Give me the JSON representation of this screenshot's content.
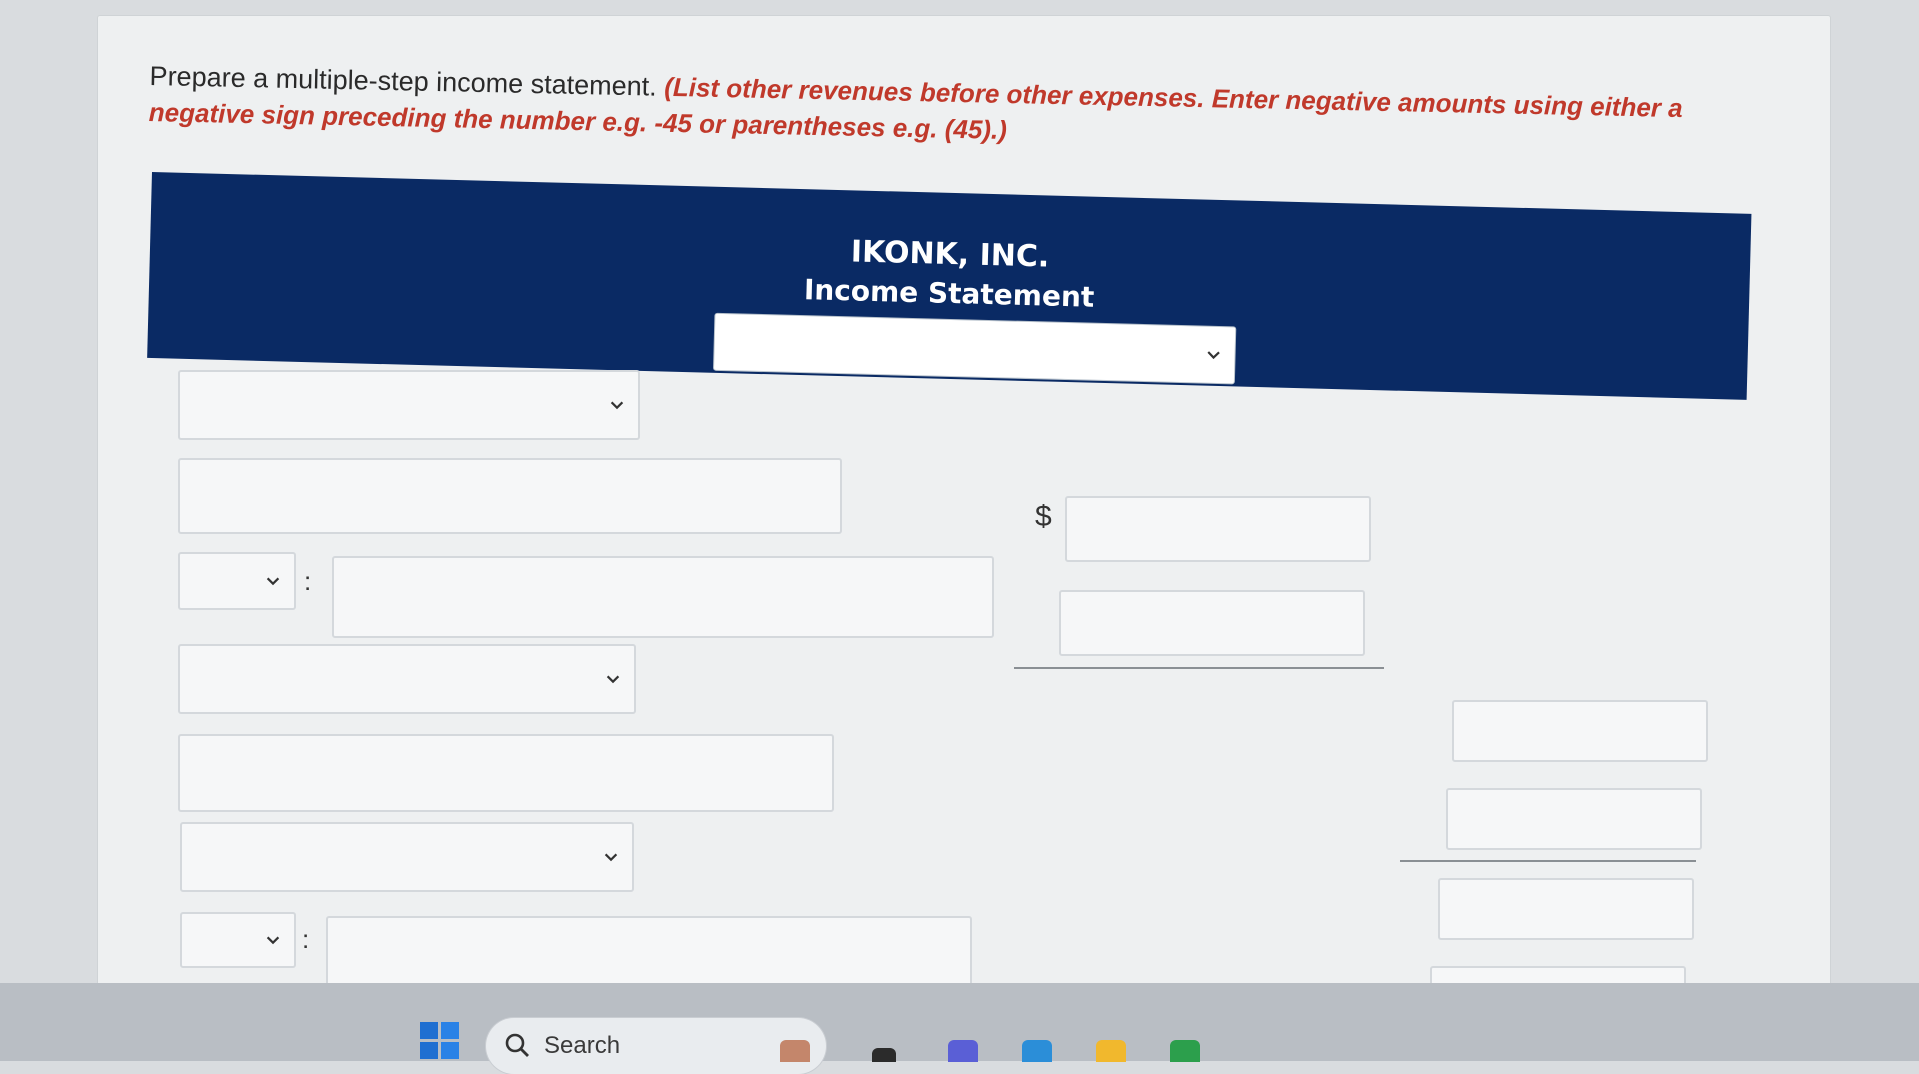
{
  "instructions": {
    "lead": "Prepare a multiple-step income statement.",
    "hint": "(List other revenues before other expenses. Enter negative amounts using either a negative sign preceding the number e.g. -45 or parentheses e.g. (45).)"
  },
  "header": {
    "company": "IKONK, INC.",
    "statement": "Income Statement",
    "period_select": ""
  },
  "form": {
    "colon": ":",
    "currency": "$",
    "rows": [
      {
        "type": "select",
        "value": ""
      },
      {
        "type": "text",
        "value": "",
        "amount": ""
      },
      {
        "type": "small-select",
        "value": "",
        "text": "",
        "amount": ""
      },
      {
        "type": "select",
        "value": ""
      },
      {
        "type": "text",
        "value": "",
        "total": ""
      },
      {
        "type": "select",
        "value": "",
        "total": ""
      },
      {
        "type": "small-select",
        "value": "",
        "text": "",
        "total": ""
      }
    ]
  },
  "taskbar": {
    "search_label": "Search"
  }
}
